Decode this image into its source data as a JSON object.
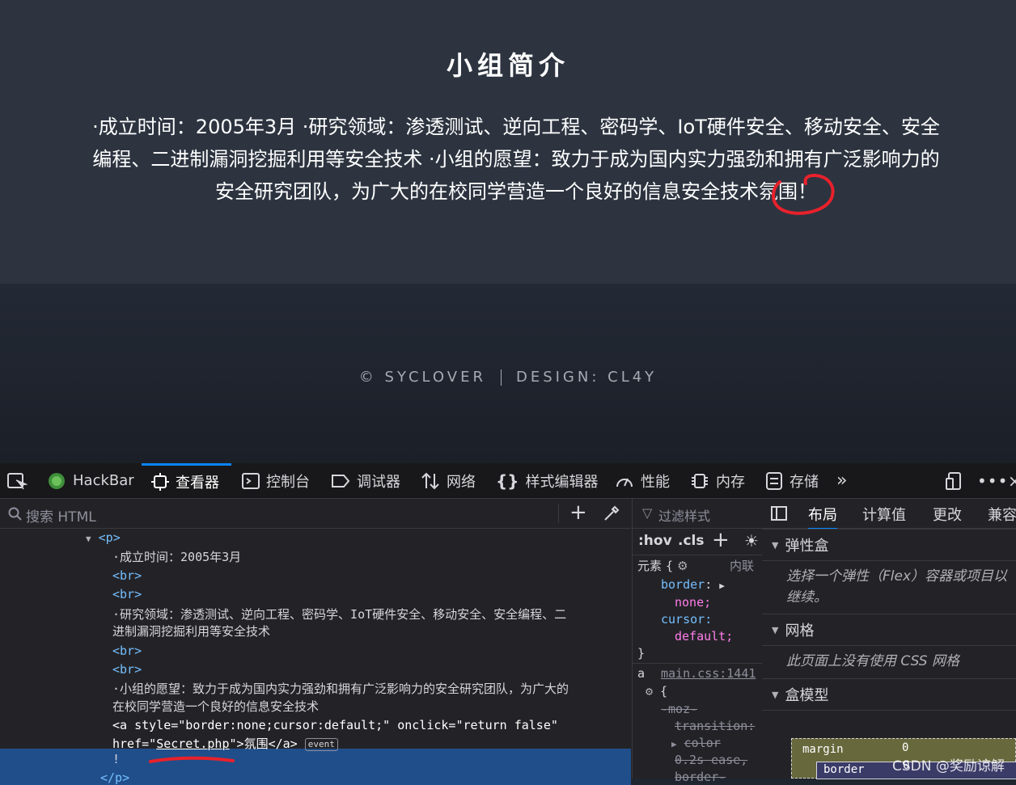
{
  "page": {
    "title": "小组简介",
    "intro_line1": "·成立时间：2005年3月 ·研究领域：渗透测试、逆向工程、密码学、IoT硬件安全、移动安全、安全",
    "intro_line2": "编程、二进制漏洞挖掘利用等安全技术 ·小组的愿望：致力于成为国内实力强劲和拥有广泛影响力的",
    "intro_line3_a": "安全研究团队，为广大的在校同学营造一个良好的信息安全技术",
    "intro_line3_b": "氛围！",
    "footer_left": "© SYCLOVER",
    "footer_right": "DESIGN: CL4Y",
    "annotation_color": "#e8212b"
  },
  "devtools": {
    "tabs": [
      "HackBar",
      "查看器",
      "控制台",
      "调试器",
      "网络",
      "样式编辑器",
      "性能",
      "内存",
      "存储"
    ],
    "search_placeholder": "搜索 HTML",
    "tree": {
      "p_open": "<p>",
      "text1": "·成立时间：2005年3月",
      "br": "<br>",
      "text2a": "·研究领域：渗透测试、逆向工程、密码学、IoT硬件安全、移动安全、安全编程、二",
      "text2b": "进制漏洞挖掘利用等安全技术",
      "text3a": "·小组的愿望：致力于成为国内实力强劲和拥有广泛影响力的安全研究团队，为广大的",
      "text3b": "在校同学营造一个良好的信息安全技术",
      "a_tag": "<a",
      "a_attr_style": "style=",
      "a_val_style": "\"border:none;cursor:default;\"",
      "a_attr_onclick": "onclick=",
      "a_val_onclick": "\"return false\"",
      "a_attr_href": "href=",
      "a_val_href": "Secret.php",
      "a_text": "氛围",
      "a_close": "</a>",
      "event_badge": "event",
      "exclaim": "!",
      "p_close": "</p>"
    },
    "rules": {
      "filter_placeholder": "过滤样式",
      "hov": ":hov",
      "cls": ".cls",
      "element_label": "元素",
      "inline_label": "内联",
      "prop1": "border",
      "val1": "none;",
      "prop2": "cursor",
      "val2": "default;",
      "selector2": "a",
      "source2": "main.css:1441",
      "struck1": "-moz-",
      "struck2": "transition:",
      "struck3": "color",
      "struck4": "0.2s ease,",
      "struck5": "border-"
    },
    "layout": {
      "tabs": [
        "布局",
        "计算值",
        "更改",
        "兼容"
      ],
      "flex_title": "弹性盒",
      "flex_body": "选择一个弹性（Flex）容器或项目以继续。",
      "grid_title": "网格",
      "grid_body": "此页面上没有使用 CSS 网格",
      "box_title": "盒模型",
      "margin_label": "margin",
      "margin_value": "0",
      "border_label": "border",
      "border_value": "0"
    }
  },
  "watermark": "CSDN @奖励谅解"
}
